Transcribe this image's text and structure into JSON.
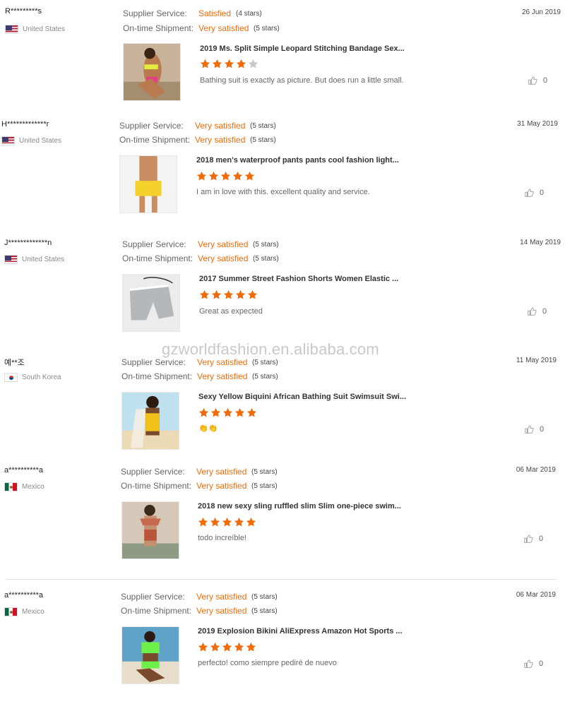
{
  "watermark": "gzworldfashion.en.alibaba.com",
  "labels": {
    "supplier_service": "Supplier Service:",
    "ontime_shipment": "On-time Shipment:"
  },
  "colors": {
    "accent": "#f06c0a",
    "star_empty": "#c8c8c8"
  },
  "reviews": [
    {
      "user": "R*********s",
      "country": "United States",
      "flag": "us",
      "supplier_rating": "Satisfied",
      "supplier_stars": "(4 stars)",
      "shipment_rating": "Very satisfied",
      "shipment_stars": "(5 stars)",
      "date": "26 Jun 2019",
      "product_title": "2019 Ms. Split Simple Leopard Stitching Bandage Sex...",
      "rating": 4,
      "comment": "Bathing suit is exactly as picture. But does run a little small.",
      "likes": "0"
    },
    {
      "user": "H*************r",
      "country": "United States",
      "flag": "us",
      "supplier_rating": "Very satisfied",
      "supplier_stars": "(5 stars)",
      "shipment_rating": "Very satisfied",
      "shipment_stars": "(5 stars)",
      "date": "31 May 2019",
      "product_title": "2018 men's waterproof pants pants cool fashion light...",
      "rating": 5,
      "comment": "I am in love with this. excellent quality and service.",
      "likes": "0"
    },
    {
      "user": "J*************n",
      "country": "United States",
      "flag": "us",
      "supplier_rating": "Very satisfied",
      "supplier_stars": "(5 stars)",
      "shipment_rating": "Very satisfied",
      "shipment_stars": "(5 stars)",
      "date": "14 May 2019",
      "product_title": "2017 Summer Street Fashion Shorts Women Elastic ...",
      "rating": 5,
      "comment": "Great as expected",
      "likes": "0"
    },
    {
      "user": "예**조",
      "country": "South Korea",
      "flag": "kr",
      "supplier_rating": "Very satisfied",
      "supplier_stars": "(5 stars)",
      "shipment_rating": "Very satisfied",
      "shipment_stars": "(5 stars)",
      "date": "11 May 2019",
      "product_title": "Sexy Yellow Biquini African Bathing Suit Swimsuit Swi...",
      "rating": 5,
      "comment": "👏👏",
      "likes": "0"
    },
    {
      "user": "a**********a",
      "country": "Mexico",
      "flag": "mx",
      "supplier_rating": "Very satisfied",
      "supplier_stars": "(5 stars)",
      "shipment_rating": "Very satisfied",
      "shipment_stars": "(5 stars)",
      "date": "06 Mar 2019",
      "product_title": "2018 new sexy sling ruffled slim Slim one-piece swim...",
      "rating": 5,
      "comment": "todo increíble!",
      "likes": "0"
    },
    {
      "user": "a**********a",
      "country": "Mexico",
      "flag": "mx",
      "supplier_rating": "Very satisfied",
      "supplier_stars": "(5 stars)",
      "shipment_rating": "Very satisfied",
      "shipment_stars": "(5 stars)",
      "date": "06 Mar 2019",
      "product_title": "2019 Explosion Bikini AliExpress Amazon Hot Sports ...",
      "rating": 5,
      "comment": "perfecto! como siempre pediré de nuevo",
      "likes": "0"
    }
  ]
}
